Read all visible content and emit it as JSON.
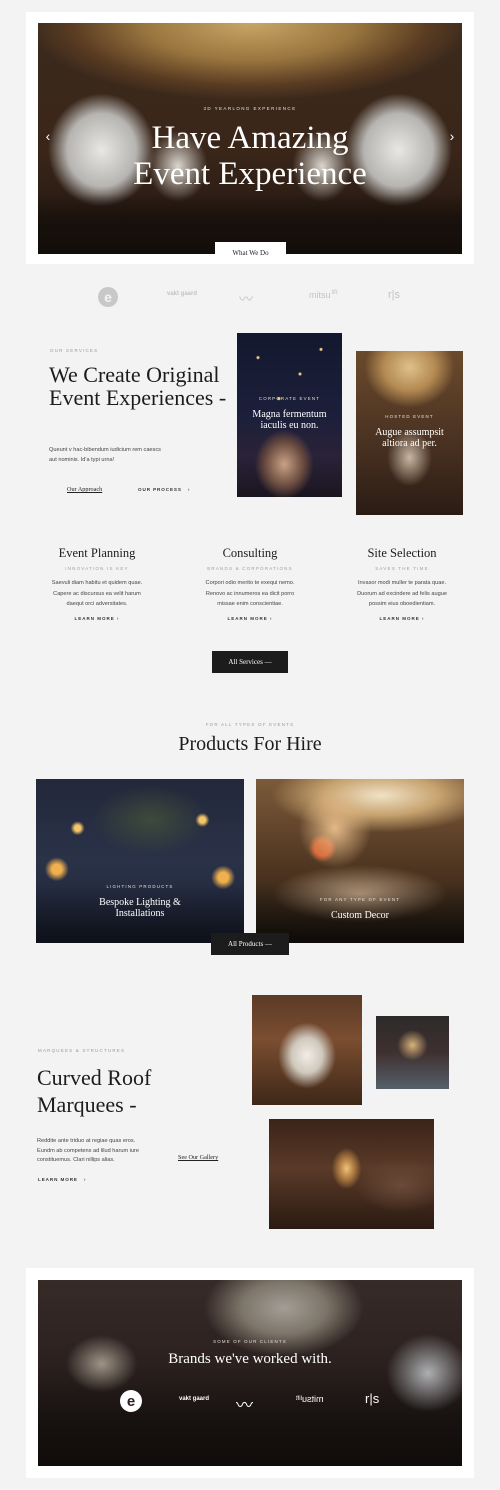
{
  "hero": {
    "kicker": "3D Yearlong Experience",
    "title_line1": "Have Amazing",
    "title_line2": "Event Experience",
    "prev_arrow": "‹",
    "next_arrow": "›",
    "cta": "What We Do"
  },
  "logos": [
    {
      "name": "e-logo",
      "text": "e"
    },
    {
      "name": "vakt-logo",
      "text": "vakt gaard"
    },
    {
      "name": "wave-logo",
      "text": "〰"
    },
    {
      "name": "mitsu-logo",
      "text": "mitsu",
      "sup": "lift"
    },
    {
      "name": "rs-logo",
      "text": "r|s"
    }
  ],
  "services_intro": {
    "kicker": "Our Services",
    "title": "We Create Original Event Experiences -",
    "text_line1": "Queunt v hac-bibendum iudicium rem caescs",
    "text_line2": "aut nominis. Id'a typi urna!",
    "approach_link": "Our Approach",
    "process_link": "Our Process",
    "arrow": "›"
  },
  "feature_cards": [
    {
      "kicker": "Corporate Event",
      "title": "Magna fermentum iaculis eu non."
    },
    {
      "kicker": "Hosted Event",
      "title": "Augue assumpsit altiora ad per."
    }
  ],
  "services": [
    {
      "title": "Event Planning",
      "subtitle": "Innovation is key",
      "text_line1": "Saevuli diam habitu et quidem quae.",
      "text_line2": "Capere ac discursus ea velit harum",
      "text_line3": "daequt orci adversitates.",
      "more": "Learn More"
    },
    {
      "title": "Consulting",
      "subtitle": "Brands & Corporations",
      "text_line1": "Corpori odio merito te exequi nemo.",
      "text_line2": "Renovo ac innumeros ea dicit porro",
      "text_line3": "missae enim conscientiae.",
      "more": "Learn More"
    },
    {
      "title": "Site Selection",
      "subtitle": "Saves the time",
      "text_line1": "Invasor modi muller te parata quae.",
      "text_line2": "Duorum ad excindere ad felis augue",
      "text_line3": "possim eius oboedientiam.",
      "more": "Learn More"
    }
  ],
  "all_services_btn": "All Services —",
  "products": {
    "kicker": "For All Types of Events",
    "title": "Products For Hire",
    "items": [
      {
        "kicker": "Lighting Products",
        "title_line1": "Bespoke Lighting &",
        "title_line2": "Installations"
      },
      {
        "kicker": "For Any Type of Event",
        "title_line1": "Custom Decor",
        "title_line2": ""
      }
    ],
    "all_btn": "All Products —"
  },
  "marquees": {
    "kicker": "Marquees & Structures",
    "title_line1": "Curved Roof",
    "title_line2": "Marquees -",
    "text_line1": "Reddite ante triduo at regiae quas eros.",
    "text_line2": "Eundm ab competens ad lilud harum iure",
    "text_line3": "constituemus. Clari nillips alias.",
    "gallery_link": "See Our Gallery",
    "more": "Learn More",
    "arrow": "›"
  },
  "brands": {
    "kicker": "Some of Our Clients",
    "title": "Brands we've worked with."
  },
  "colors": {
    "bg": "#f3f3f3",
    "dark": "#1c1c1c",
    "muted": "#9a9a9a"
  }
}
